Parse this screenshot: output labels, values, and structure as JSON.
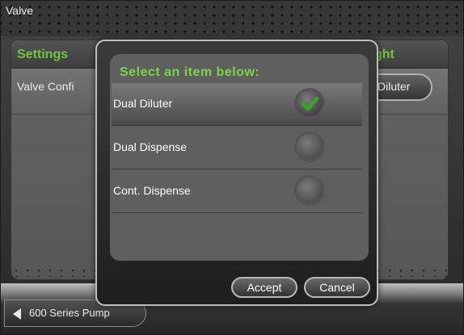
{
  "window": {
    "title": "Valve"
  },
  "panel": {
    "left_title": "Settings",
    "right_title": "ght",
    "row_label": "Valve Confi",
    "row_value": "Diluter"
  },
  "bottom": {
    "back_label": "600 Series Pump"
  },
  "dialog": {
    "title": "Select an item below:",
    "options": [
      {
        "label": "Dual Diluter",
        "selected": true
      },
      {
        "label": "Dual Dispense",
        "selected": false
      },
      {
        "label": "Cont. Dispense",
        "selected": false
      }
    ],
    "accept_label": "Accept",
    "cancel_label": "Cancel"
  },
  "colors": {
    "accent": "#7bd44a",
    "check_green": "#3aa32a"
  },
  "icons": {
    "back": "left-triangle-icon",
    "checked": "checkmark-icon",
    "radio": "radio-circle-icon"
  }
}
